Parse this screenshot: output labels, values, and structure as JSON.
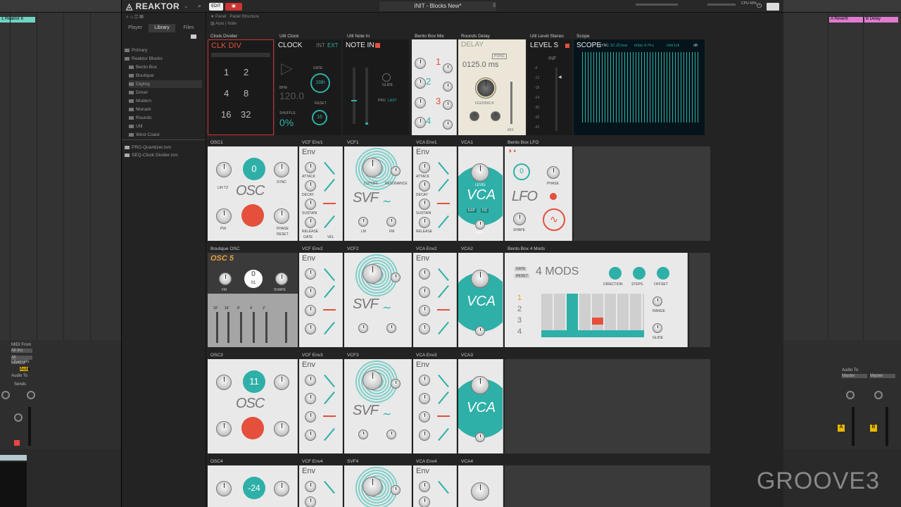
{
  "app": {
    "brand": "REAKTOR",
    "edit": "EDIT",
    "instrument": "INIT - Blocks New*",
    "cpu": "CPU 43%"
  },
  "sidebar": {
    "tabs": [
      "Player",
      "Library",
      "Files"
    ],
    "tree": [
      "Primary",
      "Reaktor Blocks",
      "Bento Box",
      "Boutique",
      "Digilog",
      "Driver",
      "Modern",
      "Monark",
      "Rounds",
      "Util",
      "West Coast",
      "PRO-Quantizer.ism",
      "SEQ-Clock Divider.ism"
    ]
  },
  "panel_tabs": [
    "Panel",
    "Panel Structure"
  ],
  "view_tabs": [
    "Auto",
    "Note"
  ],
  "row1": {
    "headers": [
      "Clock Divider",
      "Util Clock",
      "Util Note In",
      "Bento Box Mix",
      "Rounds Delay",
      "Util Level Stereo",
      "Scope"
    ],
    "clkdiv": {
      "title": "CLK DIV",
      "vals": [
        "1",
        "2",
        "4",
        "8",
        "16",
        "32"
      ]
    },
    "clock": {
      "title": "CLOCK",
      "int": "INT",
      "ext": "EXT",
      "gate": "GATE",
      "rate": "16th",
      "bpm_label": "BPM",
      "bpm": "120.0",
      "shuffle_label": "SHUFFLE",
      "shuffle": "0%",
      "reset": "RESET",
      "steps": "16"
    },
    "notein": {
      "title": "NOTE IN",
      "glide": "GLIDE",
      "pro": "PRO",
      "last": "LAST"
    },
    "mix": {
      "vals": [
        "1",
        "2",
        "3",
        "4"
      ]
    },
    "delay": {
      "title": "DELAY",
      "time": "0125.0 ms",
      "pong": "PONG",
      "feedback": "FEEDBACK",
      "mix": "MIX"
    },
    "level": {
      "title": "LEVEL S",
      "inf": "INF",
      "scale": [
        "-6",
        "-12",
        "-18",
        "-24",
        "-30",
        "-36",
        "-42"
      ]
    },
    "scope": {
      "title": "SCOPE",
      "sync": "SYNC",
      "zcross": "SC ZCross",
      "msec": "mSec 4.74 s",
      "unit": "Unit 1ch",
      "db": "dB"
    }
  },
  "row2": {
    "headers": [
      "OSC1",
      "VCF Env1",
      "VCF1",
      "VCA Env1",
      "VCA1",
      "Bento Box LFO"
    ],
    "osc": {
      "name": "OSC",
      "pitch": "0",
      "lin": "LIN TZ",
      "sync": "SYNC",
      "pw": "PW",
      "phase": "PHASE",
      "reset": "RESET",
      "osc": "OSC"
    },
    "env": {
      "name": "Env",
      "attack": "ATTACK",
      "decay": "DECAY",
      "sustain": "SUSTAIN",
      "release": "RELEASE",
      "gate": "GATE",
      "vel": "VEL"
    },
    "svf": {
      "name": "SVF",
      "cutoff": "CUTOFF",
      "resonance": "RESONANCE",
      "lm": "LM",
      "fm": "FM"
    },
    "vca": {
      "name": "VCA",
      "level": "LEVEL",
      "exp": "EXP",
      "dc": "DC",
      "gain": "GAIN"
    },
    "lfo": {
      "name": "LFO",
      "rate": "0",
      "phase": "PHASE",
      "shape": "SHAPE"
    }
  },
  "row3": {
    "headers": [
      "Boutique OSC",
      "VCF Env2",
      "VCF2",
      "VCA Env2",
      "VCA2",
      "Bento Box 4 Mods"
    ],
    "osc5": {
      "name": "OSC 5",
      "fm": "FM",
      "pitch": "0",
      "fine": "01",
      "shape": "SHAPE",
      "sl": [
        "32'",
        "16'",
        "8'",
        "4'",
        "2'"
      ]
    },
    "mods": {
      "name": "4 MODS",
      "direction": "DIRECTION",
      "steps": "STEPS",
      "offset": "OFFSET",
      "range": "RANGE",
      "glide": "GLIDE",
      "gate": "GATE",
      "reset": "RESET",
      "rows": [
        "1",
        "2",
        "3",
        "4"
      ]
    }
  },
  "row4": {
    "headers": [
      "OSC3",
      "VCF Env3",
      "VCF3",
      "VCA Env3",
      "VCA3"
    ],
    "pitch": "11"
  },
  "row5": {
    "headers": [
      "OSC4",
      "VCF Env4",
      "SVF4",
      "VCA Env4",
      "VCA4"
    ],
    "pitch": "-24"
  },
  "daw": {
    "left_tracks": [
      "1 Reaktor 6"
    ],
    "right_tracks": [
      "A Reverb",
      "B Delay"
    ],
    "audio_to": "Audio To",
    "master": "Master",
    "sends": "Sends",
    "midi_from": "MIDI From",
    "all_ins": "All Ins",
    "all_channels": "All Channels",
    "monitor": "Monitor",
    "auto": "Auto",
    "in": "In",
    "off": "Off",
    "meter_labels": [
      "-inf",
      "-inf"
    ]
  },
  "watermark": "GROOVE3"
}
